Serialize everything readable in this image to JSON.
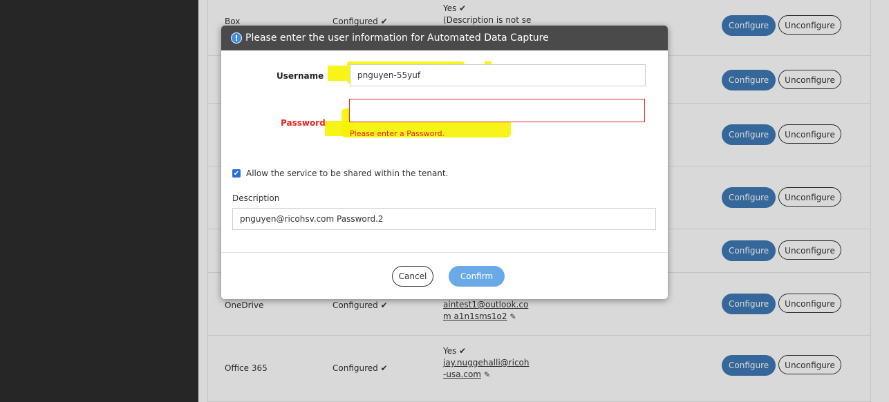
{
  "modal": {
    "title": "Please enter the user information for Automated Data Capture",
    "username_label": "Username",
    "username_value": "pnguyen-55yuf",
    "password_label": "Password",
    "password_value": "",
    "password_error": "Please enter a Password.",
    "share_checkbox_label": "Allow the service to be shared within the tenant.",
    "share_checked": true,
    "description_label": "Description",
    "description_value": "pnguyen@ricohsv.com Password.2",
    "cancel_label": "Cancel",
    "confirm_label": "Confirm"
  },
  "table": {
    "rows": [
      {
        "service": "Box",
        "status": "Configured ✔",
        "info_line1": "Yes ✔",
        "info_line2": "(Description is not se",
        "configure_label": "Configure",
        "unconfigure_label": "Unconfigure"
      },
      {
        "service": "",
        "status": "",
        "info_line1": "",
        "info_line2": "",
        "configure_label": "Configure",
        "unconfigure_label": "Unconfigure"
      },
      {
        "service": "",
        "status": "",
        "info_line1": "",
        "info_line2": "",
        "configure_label": "Configure",
        "unconfigure_label": "Unconfigure"
      },
      {
        "service": "",
        "status": "",
        "info_line1": "",
        "info_line2": "",
        "configure_label": "Configure",
        "unconfigure_label": "Unconfigure"
      },
      {
        "service": "",
        "status": "",
        "info_line1": "",
        "info_line2": "",
        "configure_label": "Configure",
        "unconfigure_label": "Unconfigure"
      },
      {
        "service": "OneDrive",
        "status": "Configured ✔",
        "info_line1": "aintest1@outlook.co",
        "info_line2": "m a1n1sms1o2",
        "configure_label": "Configure",
        "unconfigure_label": "Unconfigure"
      },
      {
        "service": "Office 365",
        "status": "Configured ✔",
        "info_line1": "Yes ✔",
        "info_line2": "jay.nuggehalli@ricoh",
        "info_line3": "-usa.com",
        "configure_label": "Configure",
        "unconfigure_label": "Unconfigure"
      }
    ]
  },
  "colors": {
    "sidebar_bg": "#262626",
    "modal_header_bg": "#4a4a4a",
    "primary_button": "#3f79b6",
    "error": "#e22222",
    "highlight": "#f5f300"
  }
}
